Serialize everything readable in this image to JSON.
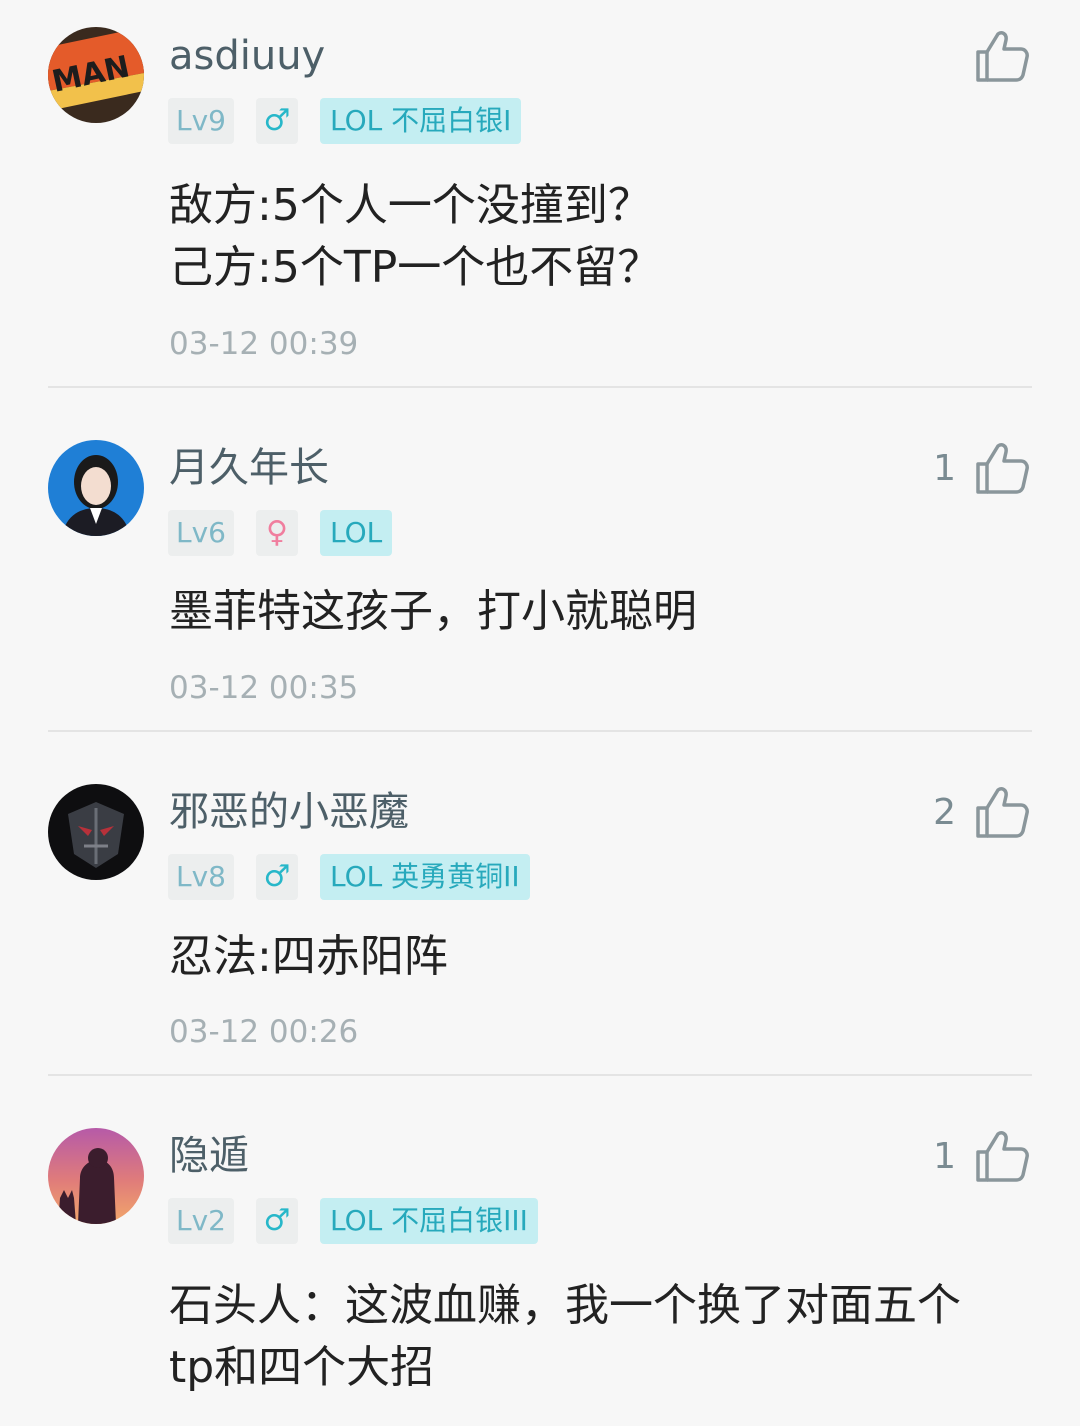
{
  "colors": {
    "username": "#4d5f68",
    "badge_bg": "#eceeee",
    "level_text": "#7fb8c7",
    "game_badge_bg": "#c4eef2",
    "game_badge_text": "#27a9bc",
    "male": "#27b7c9",
    "female": "#f07e9e",
    "timestamp": "#a6b0b4"
  },
  "comments": [
    {
      "username": "asdiuuy",
      "avatar_text": "MAN",
      "level": "Lv9",
      "gender": "♂",
      "gender_icon": "male-icon",
      "game_badge": "LOL 不屈白银I",
      "text": "敌方:5个人一个没撞到？\n己方:5个TP一个也不留？",
      "time": "03-12 00:39",
      "likes": ""
    },
    {
      "username": "月久年长",
      "level": "Lv6",
      "gender": "♀",
      "gender_icon": "female-icon",
      "game_badge": "LOL",
      "text": "墨菲特这孩子，打小就聪明",
      "time": "03-12 00:35",
      "likes": "1"
    },
    {
      "username": "邪恶的小恶魔",
      "level": "Lv8",
      "gender": "♂",
      "gender_icon": "male-icon",
      "game_badge": "LOL 英勇黄铜II",
      "text": "忍法:四赤阳阵",
      "time": "03-12 00:26",
      "likes": "2"
    },
    {
      "username": "隐遁",
      "level": "Lv2",
      "gender": "♂",
      "gender_icon": "male-icon",
      "game_badge": "LOL 不屈白银III",
      "text": "石头人：这波血赚，我一个换了对面五个\ntp和四个大招",
      "time": "",
      "likes": "1"
    }
  ]
}
